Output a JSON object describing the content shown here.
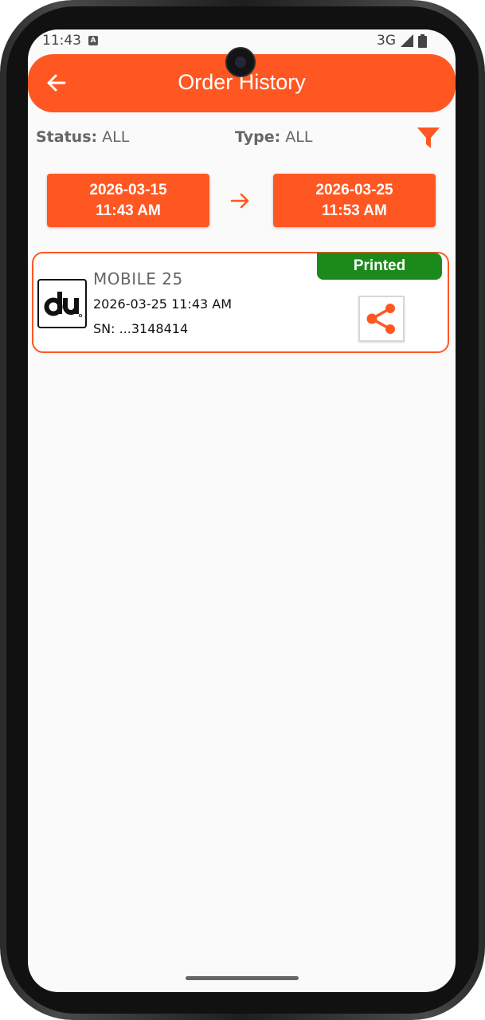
{
  "status_bar": {
    "time": "11:43",
    "network": "3G"
  },
  "header": {
    "title": "Order History"
  },
  "filters": {
    "status_label": "Status:",
    "status_value": "ALL",
    "type_label": "Type:",
    "type_value": "ALL"
  },
  "date_range": {
    "start_date": "2026-03-15",
    "start_time": "11:43 AM",
    "end_date": "2026-03-25",
    "end_time": "11:53 AM"
  },
  "orders": [
    {
      "title": "MOBILE 25",
      "datetime": "2026-03-25 11:43 AM",
      "serial": "SN: ...3148414",
      "status": "Printed"
    }
  ],
  "colors": {
    "accent": "#FF5722",
    "status_printed": "#1B8A1B"
  }
}
